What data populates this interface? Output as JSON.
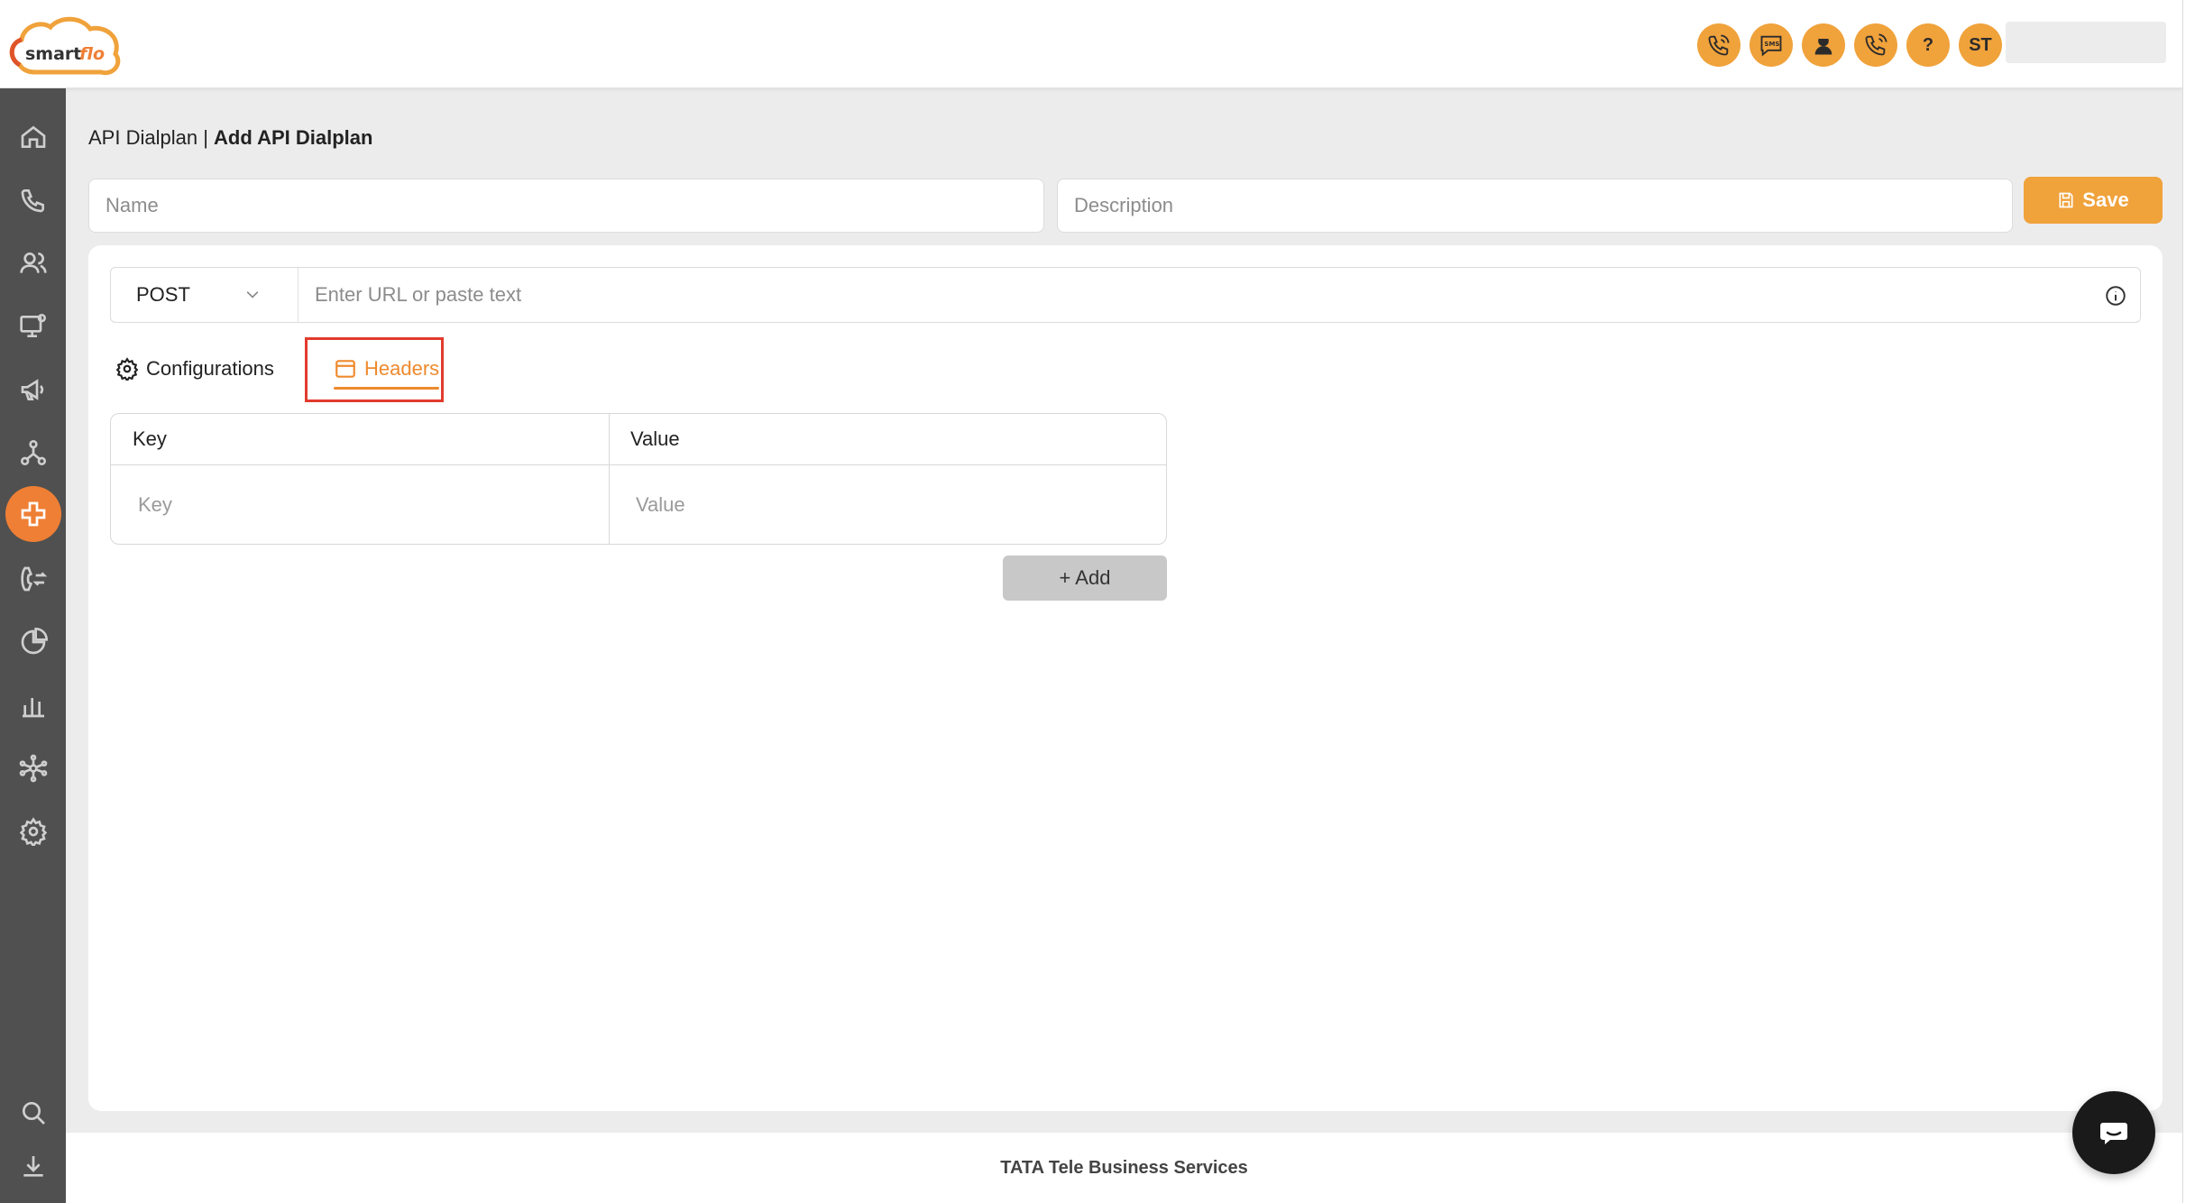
{
  "header": {
    "logo_text": "smartflo",
    "icons": [
      "phone-call-icon",
      "sms-icon",
      "agent-icon",
      "phone-ring-icon",
      "help-icon"
    ],
    "sms_label": "SMS",
    "help_label": "?",
    "user_initials": "ST"
  },
  "sidebar": {
    "items": [
      "home-icon",
      "phone-icon",
      "users-icon",
      "monitor-settings-icon",
      "megaphone-icon",
      "network-icon",
      "api-dialplan-icon",
      "call-transfer-icon",
      "pie-chart-icon",
      "bar-chart-icon",
      "hub-icon",
      "settings-icon"
    ],
    "active": "api-dialplan-icon",
    "bottom": [
      "search-icon",
      "download-icon"
    ]
  },
  "breadcrumb": {
    "parent": "API Dialplan",
    "separator": " | ",
    "current": "Add API Dialplan"
  },
  "form": {
    "name_placeholder": "Name",
    "description_placeholder": "Description",
    "save_label": "Save"
  },
  "request": {
    "method": "POST",
    "url_placeholder": "Enter URL or paste text"
  },
  "tabs": {
    "configurations": "Configurations",
    "headers": "Headers",
    "active": "headers"
  },
  "headers_table": {
    "columns": [
      "Key",
      "Value"
    ],
    "key_placeholder": "Key",
    "value_placeholder": "Value",
    "add_label": "+ Add"
  },
  "footer": {
    "text": "TATA Tele Business Services"
  },
  "colors": {
    "accent": "#f0a23b",
    "active_tab": "#ee8a2d",
    "sidebar": "#505050",
    "highlight": "#e23b2e"
  }
}
